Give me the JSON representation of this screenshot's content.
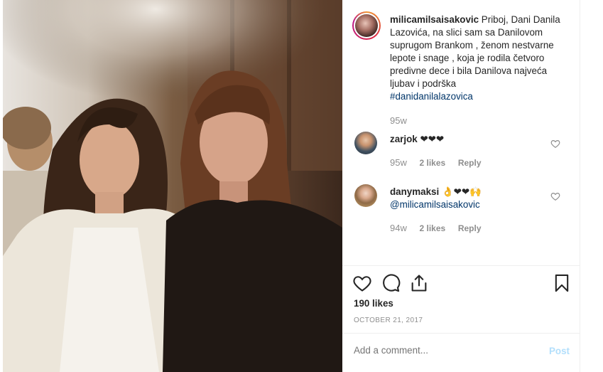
{
  "post": {
    "image_alt": "Two women smiling together at an event",
    "author": "milicamilsaisakovic",
    "caption": "Priboj, Dani Danila Lazovića, na slici sam sa Danilovom suprugom Brankom , ženom nestvarne lepote i snage , koja je rodila četvoro predivne dece i bila Danilova najveća ljubav i podrška",
    "hashtag": "#danidanilalazovica",
    "caption_time": "95w"
  },
  "comments": [
    {
      "user": "zarjok",
      "text": "❤❤❤",
      "time": "95w",
      "likes": "2 likes",
      "reply": "Reply"
    },
    {
      "user": "danymaksi",
      "text": "👌❤❤🙌",
      "mention": "@milicamilsaisakovic",
      "time": "94w",
      "likes": "2 likes",
      "reply": "Reply"
    }
  ],
  "stats": {
    "likes": "190 likes",
    "date": "OCTOBER 21, 2017"
  },
  "composer": {
    "placeholder": "Add a comment...",
    "post_label": "Post"
  },
  "icons": [
    "heart-icon",
    "comment-icon",
    "share-icon",
    "bookmark-icon",
    "comment-like-icon"
  ],
  "colors": {
    "link": "#003569",
    "muted": "#8e8e8e",
    "post_disabled": "#b2dffc"
  }
}
